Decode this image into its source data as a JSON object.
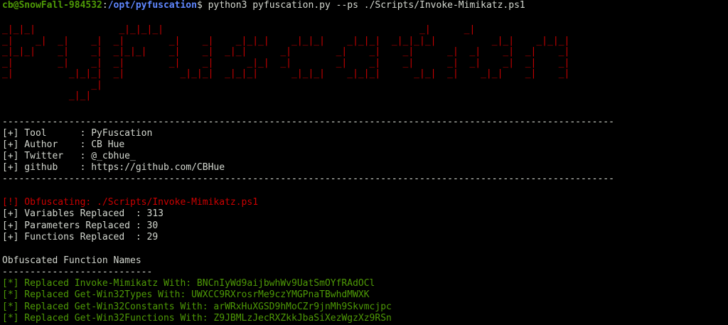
{
  "prompt": {
    "user_host": "cb@SnowFall-984532",
    "separator": ":",
    "path": "/opt/pyfuscation",
    "symbol": "$",
    "command": " python3 pyfuscation.py --ps ./Scripts/Invoke-Mimikatz.ps1"
  },
  "banner_art": [
    "_|_|_|               _|_|_|_|                                              _|      _|",
    "_|    _|  _|    _|  _|        _|    _|    _|_|_|    _|_|_|    _|_|_|  _|_|_|_|          _|_|    _|_|_|",
    "_|_|_|    _|    _|  _|_|_|    _|    _|  _|_|      _|        _|    _|    _|      _|  _|    _|  _|    _|",
    "_|        _|    _|  _|        _|    _|      _|_|  _|        _|    _|    _|      _|  _|    _|  _|    _|",
    "_|          _|_|_|  _|          _|_|_|  _|_|_|      _|_|_|    _|_|_|      _|_|  _|    _|_|    _|    _|",
    "                _|",
    "            _|_|"
  ],
  "divider": "--------------------------------------------------------------------------------------------------------------",
  "info": [
    "[+] Tool      : PyFuscation",
    "[+] Author    : CB Hue",
    "[+] Twitter   : @_cbhue_",
    "[+] github    : https://github.com/CBHue"
  ],
  "status": {
    "obfuscating": "[!] Obfuscating: ./Scripts/Invoke-Mimikatz.ps1",
    "variables": "[+] Variables Replaced  : 313",
    "parameters": "[+] Parameters Replaced : 30",
    "functions": "[+] Functions Replaced  : 29"
  },
  "section": {
    "title": "Obfuscated Function Names",
    "underline": "---------------------------"
  },
  "replacements": [
    "[*] Replaced Invoke-Mimikatz With: BNCnIyWd9aijbwhWv9UatSmOYfRAdOCl",
    "[*] Replaced Get-Win32Types With: UWXCC9RXrosrMe9czYMGPnaTBwhdMWXK",
    "[*] Replaced Get-Win32Constants With: arWRxHuXGSD9hMoCZr9jnMh9Skvmcjpc",
    "[*] Replaced Get-Win32Functions With: Z9JBMLzJecRXZkkJbaSiXezWgzXz9RSn"
  ],
  "colors": {
    "background": "#000000",
    "foreground": "#d3d7cf",
    "user_host": "#4e9a06",
    "path": "#5f87ff",
    "banner": "#cc0000",
    "warning": "#cc0000",
    "success": "#4e9a06"
  }
}
